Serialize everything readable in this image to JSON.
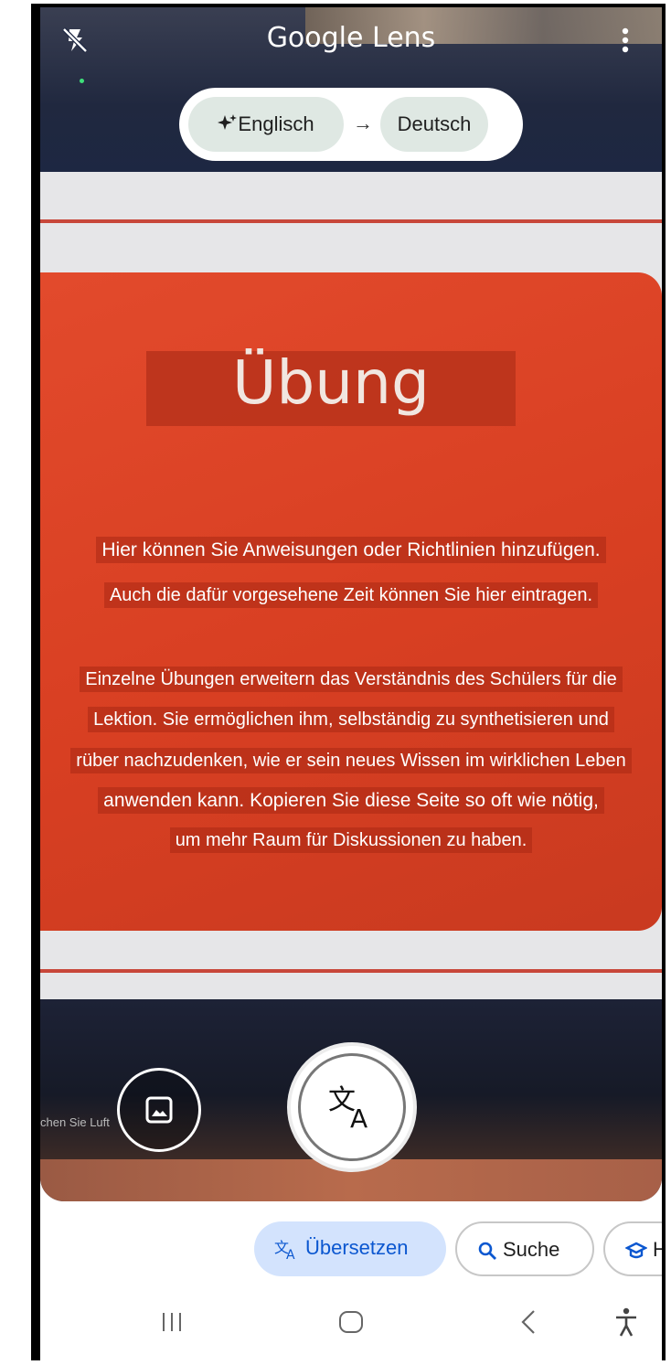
{
  "app": {
    "title": "Google Lens"
  },
  "language_selector": {
    "source": "Englisch",
    "target": "Deutsch"
  },
  "detected_text": {
    "title": "Übung",
    "lines": [
      "Hier können Sie Anweisungen oder Richtlinien hinzufügen.",
      "Auch die dafür vorgesehene Zeit können Sie hier eintragen.",
      "Einzelne Übungen erweitern das Verständnis des Schülers für die",
      "Lektion. Sie ermöglichen ihm, selbständig zu synthetisieren und",
      "rüber nachzudenken, wie er sein neues Wissen im wirklichen Leben",
      "anwenden kann. Kopieren Sie diese Seite so oft wie nötig,",
      "um mehr Raum für Diskussionen zu haben."
    ],
    "background_hint": "chen Sie Luft"
  },
  "modes": {
    "translate": "Übersetzen",
    "search": "Suche",
    "homework": "H"
  },
  "icons": {
    "flash": "flash-off-icon",
    "menu": "more-vert-icon",
    "gallery": "gallery-icon",
    "shutter": "translate-icon",
    "nav_recent": "recent-apps-icon",
    "nav_home": "home-icon",
    "nav_back": "back-icon",
    "nav_accessibility": "accessibility-icon"
  },
  "colors": {
    "accent": "#0b57d0",
    "active_chip": "#d3e3fd",
    "card": "#d83f22"
  }
}
